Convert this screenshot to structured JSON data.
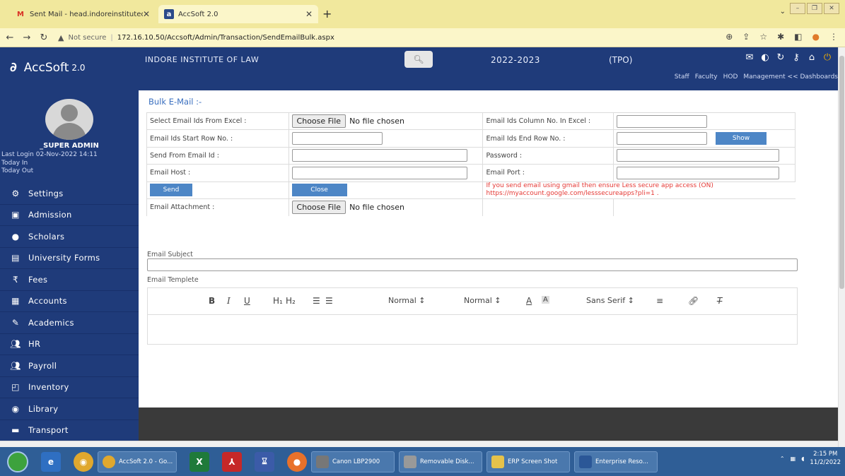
{
  "browser": {
    "tabs": [
      {
        "title": "Sent Mail - head.indoreinstitutec",
        "icon": "gmail-icon",
        "active": false
      },
      {
        "title": "AccSoft 2.0",
        "icon": "accsoft-favicon",
        "active": true
      }
    ],
    "address": {
      "security_label": "Not secure",
      "url": "172.16.10.50/Accsoft/Admin/Transaction/SendEmailBulk.aspx"
    }
  },
  "header": {
    "app_name": "AccSoft",
    "app_version": "2.0",
    "institute": "INDORE INSTITUTE OF LAW",
    "session": "2022-2023",
    "role_tag": "(TPO)",
    "links": [
      "Staff",
      "Faculty",
      "HOD",
      "Management << Dashboards"
    ]
  },
  "sidebar": {
    "user_name": "_SUPER ADMIN",
    "last_login": "Last Login  02-Nov-2022 14:11",
    "today_in": "Today In",
    "today_out": "Today Out",
    "items": [
      {
        "label": "Settings",
        "icon": "gear-icon"
      },
      {
        "label": "Admission",
        "icon": "admission-icon"
      },
      {
        "label": "Scholars",
        "icon": "user-icon"
      },
      {
        "label": "University Forms",
        "icon": "form-icon"
      },
      {
        "label": "Fees",
        "icon": "rupee-icon"
      },
      {
        "label": "Accounts",
        "icon": "ledger-icon"
      },
      {
        "label": "Academics",
        "icon": "pen-icon"
      },
      {
        "label": "HR",
        "icon": "users-icon"
      },
      {
        "label": "Payroll",
        "icon": "users-icon"
      },
      {
        "label": "Inventory",
        "icon": "box-icon"
      },
      {
        "label": "Library",
        "icon": "book-icon"
      },
      {
        "label": "Transport",
        "icon": "bus-icon"
      }
    ]
  },
  "form": {
    "title": "Bulk E-Mail :-",
    "select_excel_label": "Select Email Ids From Excel :",
    "choose_file": "Choose File",
    "no_file": "No file chosen",
    "column_no_label": "Email Ids Column No. In Excel :",
    "start_row_label": "Email Ids Start Row No. :",
    "end_row_label": "Email Ids End Row No. :",
    "show_button": "Show",
    "send_from_label": "Send From Email Id :",
    "password_label": "Password :",
    "host_label": "Email Host :",
    "port_label": "Email Port :",
    "send_button": "Send",
    "close_button": "Close",
    "notice_line1": "If you send email using gmail then ensure Less secure app access (ON)",
    "notice_line2": "https://myaccount.google.com/lesssecureapps?pli=1 .",
    "attachment_label": "Email Attachment :",
    "subject_label": "Email Subject",
    "template_label": "Email Templete"
  },
  "editor_toolbar": {
    "bold": "B",
    "italic": "I",
    "underline": "U",
    "h1": "H₁",
    "h2": "H₂",
    "size1": "Normal ↕",
    "size2": "Normal ↕",
    "font": "Sans Serif ↕"
  },
  "taskbar": {
    "tasks": [
      "AccSoft 2.0 - Go...",
      "Canon LBP2900",
      "Removable Disk...",
      "ERP Screen Shot",
      "Enterprise Reso..."
    ],
    "time": "2:15 PM",
    "date": "11/2/2022"
  },
  "colors": {
    "sidebar_bg": "#1f3b7a",
    "accent_button": "#4d86c6",
    "notice_text": "#e53935",
    "tab_strip": "#f1e89d"
  }
}
